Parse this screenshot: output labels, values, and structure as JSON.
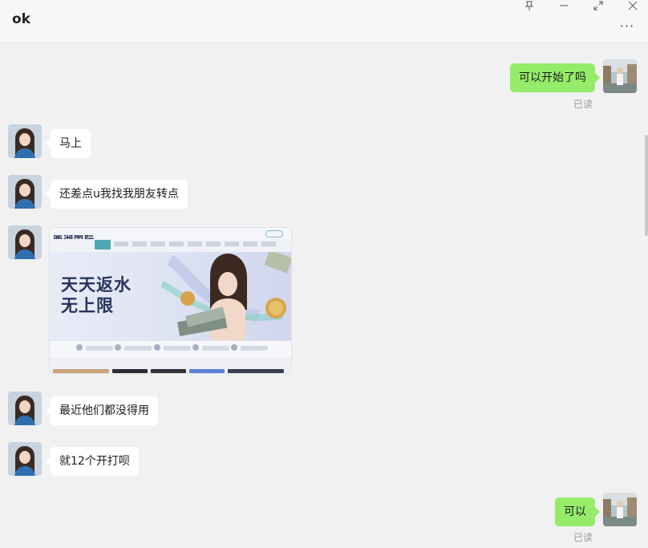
{
  "window": {
    "title": "ok",
    "more_label": "···"
  },
  "messages": [
    {
      "side": "right",
      "text": "可以开始了吗",
      "status": "已读"
    },
    {
      "side": "left",
      "text": "马上"
    },
    {
      "side": "left",
      "text": "还差点u我找我朋友转点"
    },
    {
      "side": "left",
      "type": "image",
      "image_text": {
        "logo": "西湖国际",
        "headline_line1": "天天返水",
        "headline_line2": "无上限"
      }
    },
    {
      "side": "left",
      "text": "最近他们都没得用"
    },
    {
      "side": "left",
      "text": "就12个开打呗"
    },
    {
      "side": "right",
      "text": "可以",
      "status": "已读"
    }
  ],
  "colors": {
    "background": "#f1f1f1",
    "header": "#f7f7f7",
    "bubble_self": "#95ec69",
    "bubble_other": "#ffffff",
    "read_status": "#9a9a9a"
  },
  "icons": [
    "pin-icon",
    "minimize-icon",
    "maximize-icon",
    "close-icon",
    "more-icon"
  ]
}
